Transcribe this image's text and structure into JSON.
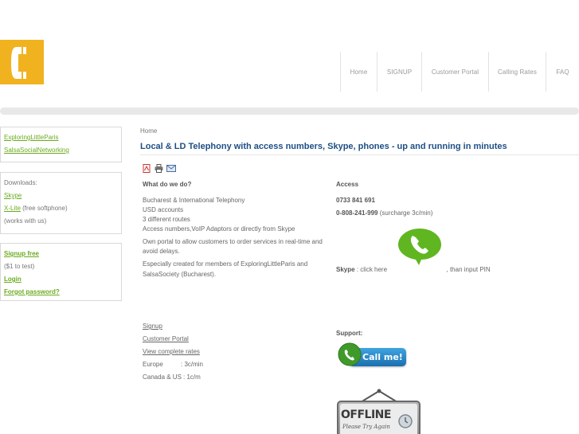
{
  "nav": {
    "items": [
      "Home",
      "SIGNUP",
      "Customer Portal",
      "Calling Rates",
      "FAQ"
    ]
  },
  "sidebar": {
    "links_box": [
      "ExploringLittleParis",
      "SalsaSocialNetworking"
    ],
    "downloads": {
      "heading": "Downloads:",
      "skype": "Skype",
      "xlite": "X-Lite",
      "xlite_note": "(free softphone)",
      "works": "(works with us)"
    },
    "account": {
      "signup": "Signup free",
      "signup_note": "($1 to test)",
      "login": "Login",
      "forgot": "Forgot password?"
    }
  },
  "main": {
    "breadcrumb": "Home",
    "title": "Local & LD Telephony with access numbers, Skype, phones - up and running in minutes",
    "what_heading": "What do we do?",
    "what_lines": [
      "Bucharest & International  Telephony",
      "USD accounts",
      "3 different routes",
      "Access numbers,VoIP Adaptors or directly from Skype"
    ],
    "portal_text_1": "Own portal to allow customers to order services in real-time and",
    "portal_text_2": "avoid delays.",
    "special_text_1": "Especially created for members of ExploringLittleParis and",
    "special_text_2": "SalsaSociety (Bucharest).",
    "access_heading": "Access",
    "access_number_1": "0733 841 691",
    "access_number_2": "0-808-241-999",
    "access_surcharge": "(surcharge 3c/min)",
    "skype_label": "Skype",
    "skype_text_1": ": click here",
    "skype_text_2": ", than input PIN",
    "links": [
      "Signup",
      "Customer Portal",
      "View complete rates"
    ],
    "rates": [
      {
        "region": "Europe",
        "price": ": 3c/min"
      },
      {
        "region": "Canada & US",
        "price": ": 1c/m"
      }
    ],
    "support_heading": "Support:",
    "callme_label": "Call me!",
    "offline_label": "OFFLINE",
    "offline_sub": "Please Try Again"
  },
  "colors": {
    "logo": "#f0b21f",
    "link": "#6aab1e",
    "title": "#1d4f86",
    "skype_bubble": "#5fb621"
  }
}
